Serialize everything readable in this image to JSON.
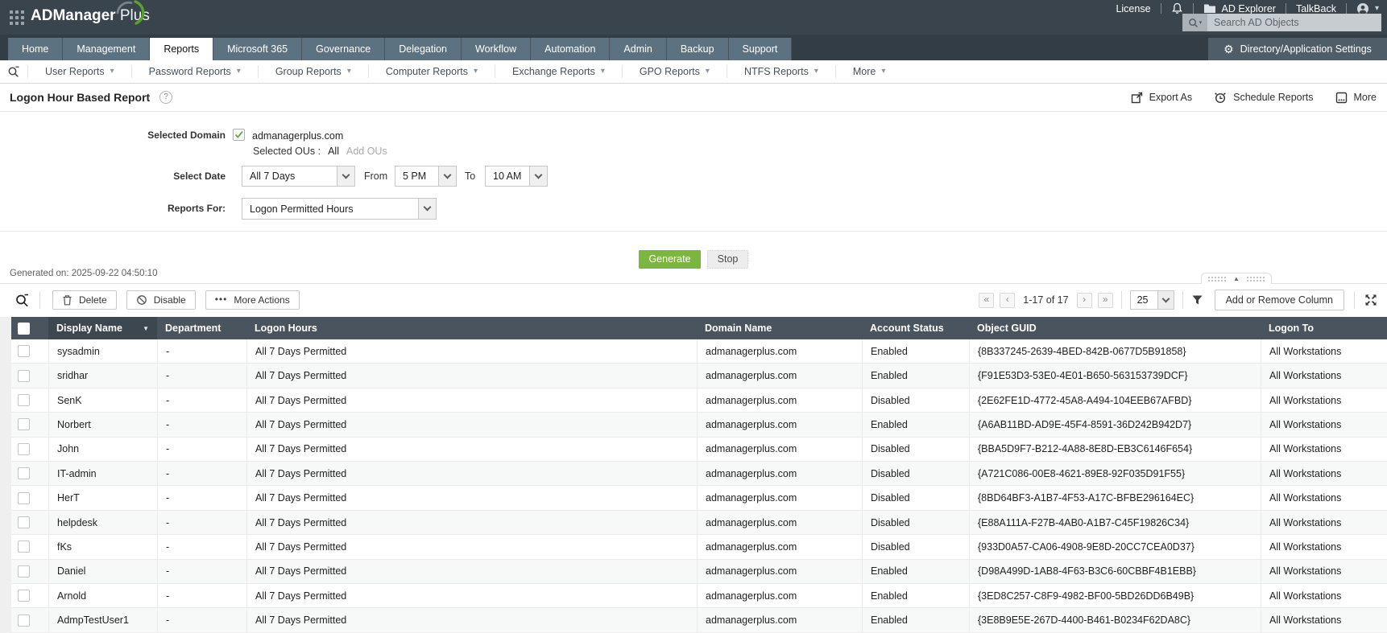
{
  "topbar": {
    "license": "License",
    "ad_explorer": "AD Explorer",
    "talkback": "TalkBack",
    "search_placeholder": "Search AD Objects",
    "brand_bold": "ADManager",
    "brand_light": "Plus"
  },
  "tabs": {
    "items": [
      {
        "label": "Home"
      },
      {
        "label": "Management"
      },
      {
        "label": "Reports",
        "active": true
      },
      {
        "label": "Microsoft 365"
      },
      {
        "label": "Governance"
      },
      {
        "label": "Delegation"
      },
      {
        "label": "Workflow"
      },
      {
        "label": "Automation"
      },
      {
        "label": "Admin"
      },
      {
        "label": "Backup"
      },
      {
        "label": "Support"
      }
    ],
    "settings_label": "Directory/Application Settings"
  },
  "reports_nav": {
    "items": [
      "User Reports",
      "Password Reports",
      "Group Reports",
      "Computer Reports",
      "Exchange Reports",
      "GPO Reports",
      "NTFS Reports",
      "More"
    ]
  },
  "page_header": {
    "title": "Logon Hour Based Report",
    "help": "?",
    "actions": [
      {
        "label": "Export As"
      },
      {
        "label": "Schedule Reports"
      },
      {
        "label": "More"
      }
    ]
  },
  "form": {
    "selected_domain_label": "Selected Domain",
    "domain": "admanagerplus.com",
    "selected_ous_label": "Selected OUs :",
    "selected_ous_value": "All",
    "add_ous_label": "Add OUs",
    "select_date_label": "Select Date",
    "date_value": "All 7 Days",
    "from_label": "From",
    "from_value": "5 PM",
    "to_label": "To",
    "to_value": "10 AM",
    "reports_for_label": "Reports For:",
    "reports_for_value": "Logon Permitted Hours",
    "generate_label": "Generate",
    "stop_label": "Stop"
  },
  "status_line": {
    "generated_on": "Generated on: 2025-09-22 04:50:10"
  },
  "toolbar": {
    "delete_label": "Delete",
    "disable_label": "Disable",
    "more_actions_label": "More Actions",
    "range": "1-17 of 17",
    "page_size": "25",
    "add_remove_column_label": "Add or Remove Column"
  },
  "table": {
    "columns": [
      "Display Name",
      "Department",
      "Logon Hours",
      "Domain Name",
      "Account Status",
      "Object GUID",
      "Logon To"
    ],
    "rows": [
      {
        "display_name": "sysadmin",
        "department": "-",
        "logon_hours": "All 7 Days Permitted",
        "domain_name": "admanagerplus.com",
        "account_status": "Enabled",
        "object_guid": "{8B337245-2639-4BED-842B-0677D5B91858}",
        "logon_to": "All Workstations"
      },
      {
        "display_name": "sridhar",
        "department": "-",
        "logon_hours": "All 7 Days Permitted",
        "domain_name": "admanagerplus.com",
        "account_status": "Enabled",
        "object_guid": "{F91E53D3-53E0-4E01-B650-563153739DCF}",
        "logon_to": "All Workstations"
      },
      {
        "display_name": "SenK",
        "department": "-",
        "logon_hours": "All 7 Days Permitted",
        "domain_name": "admanagerplus.com",
        "account_status": "Disabled",
        "object_guid": "{2E62FE1D-4772-45A8-A494-104EEB67AFBD}",
        "logon_to": "All Workstations"
      },
      {
        "display_name": "Norbert",
        "department": "-",
        "logon_hours": "All 7 Days Permitted",
        "domain_name": "admanagerplus.com",
        "account_status": "Enabled",
        "object_guid": "{A6AB11BD-AD9E-45F4-8591-36D242B942D7}",
        "logon_to": "All Workstations"
      },
      {
        "display_name": "John",
        "department": "-",
        "logon_hours": "All 7 Days Permitted",
        "domain_name": "admanagerplus.com",
        "account_status": "Disabled",
        "object_guid": "{BBA5D9F7-B212-4A88-8E8D-EB3C6146F654}",
        "logon_to": "All Workstations"
      },
      {
        "display_name": "IT-admin",
        "department": "-",
        "logon_hours": "All 7 Days Permitted",
        "domain_name": "admanagerplus.com",
        "account_status": "Disabled",
        "object_guid": "{A721C086-00E8-4621-89E8-92F035D91F55}",
        "logon_to": "All Workstations"
      },
      {
        "display_name": "HerT",
        "department": "-",
        "logon_hours": "All 7 Days Permitted",
        "domain_name": "admanagerplus.com",
        "account_status": "Disabled",
        "object_guid": "{8BD64BF3-A1B7-4F53-A17C-BFBE296164EC}",
        "logon_to": "All Workstations"
      },
      {
        "display_name": "helpdesk",
        "department": "-",
        "logon_hours": "All 7 Days Permitted",
        "domain_name": "admanagerplus.com",
        "account_status": "Disabled",
        "object_guid": "{E88A111A-F27B-4AB0-A1B7-C45F19826C34}",
        "logon_to": "All Workstations"
      },
      {
        "display_name": "fKs",
        "department": "-",
        "logon_hours": "All 7 Days Permitted",
        "domain_name": "admanagerplus.com",
        "account_status": "Disabled",
        "object_guid": "{933D0A57-CA06-4908-9E8D-20CC7CEA0D37}",
        "logon_to": "All Workstations"
      },
      {
        "display_name": "Daniel",
        "department": "-",
        "logon_hours": "All 7 Days Permitted",
        "domain_name": "admanagerplus.com",
        "account_status": "Enabled",
        "object_guid": "{D98A499D-1AB8-4F63-B3C6-60CBBF4B1EBB}",
        "logon_to": "All Workstations"
      },
      {
        "display_name": "Arnold",
        "department": "-",
        "logon_hours": "All 7 Days Permitted",
        "domain_name": "admanagerplus.com",
        "account_status": "Enabled",
        "object_guid": "{3ED8C257-C8F9-4982-BF00-5BD26DD6B49B}",
        "logon_to": "All Workstations"
      },
      {
        "display_name": "AdmpTestUser1",
        "department": "-",
        "logon_hours": "All 7 Days Permitted",
        "domain_name": "admanagerplus.com",
        "account_status": "Enabled",
        "object_guid": "{3E8B9E5E-267D-4400-B461-B0234F62DA8C}",
        "logon_to": "All Workstations"
      }
    ]
  },
  "colors": {
    "topbar": "#3a444d",
    "tab": "#5d7280",
    "table_header": "#4a545e",
    "accent_green": "#7cb53f"
  }
}
